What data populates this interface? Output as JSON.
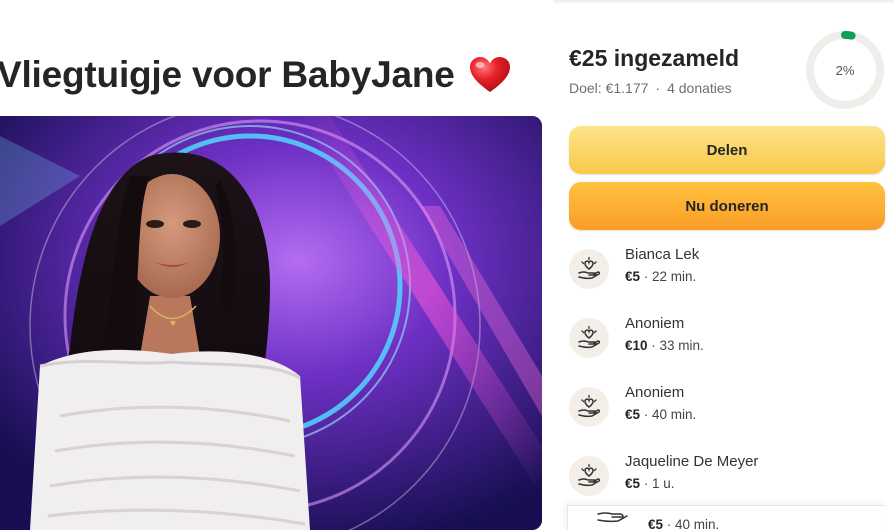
{
  "campaign": {
    "title": "Vliegtuigje voor BabyJane",
    "title_emoji": "heart-icon"
  },
  "stats": {
    "raised": "€25 ingezameld",
    "goal": "Doel: €1.177",
    "separator": "·",
    "donation_count": "4 donaties",
    "progress_label": "2%",
    "progress_fraction": 0.02,
    "progress_color": "#0f9d58"
  },
  "actions": {
    "share_label": "Delen",
    "donate_label": "Nu doneren"
  },
  "donations": [
    {
      "name": "Bianca Lek",
      "amount": "€5",
      "time": "22 min."
    },
    {
      "name": "Anoniem",
      "amount": "€10",
      "time": "33 min."
    },
    {
      "name": "Anoniem",
      "amount": "€5",
      "time": "40 min."
    },
    {
      "name": "Jaqueline De Meyer",
      "amount": "€5",
      "time": "1 u."
    }
  ],
  "overlay_donation": {
    "amount": "€5",
    "time": "40 min."
  },
  "colors": {
    "share_button": "#f7c94a",
    "donate_button": "#f99d28",
    "ring_track": "#eeeeea"
  }
}
